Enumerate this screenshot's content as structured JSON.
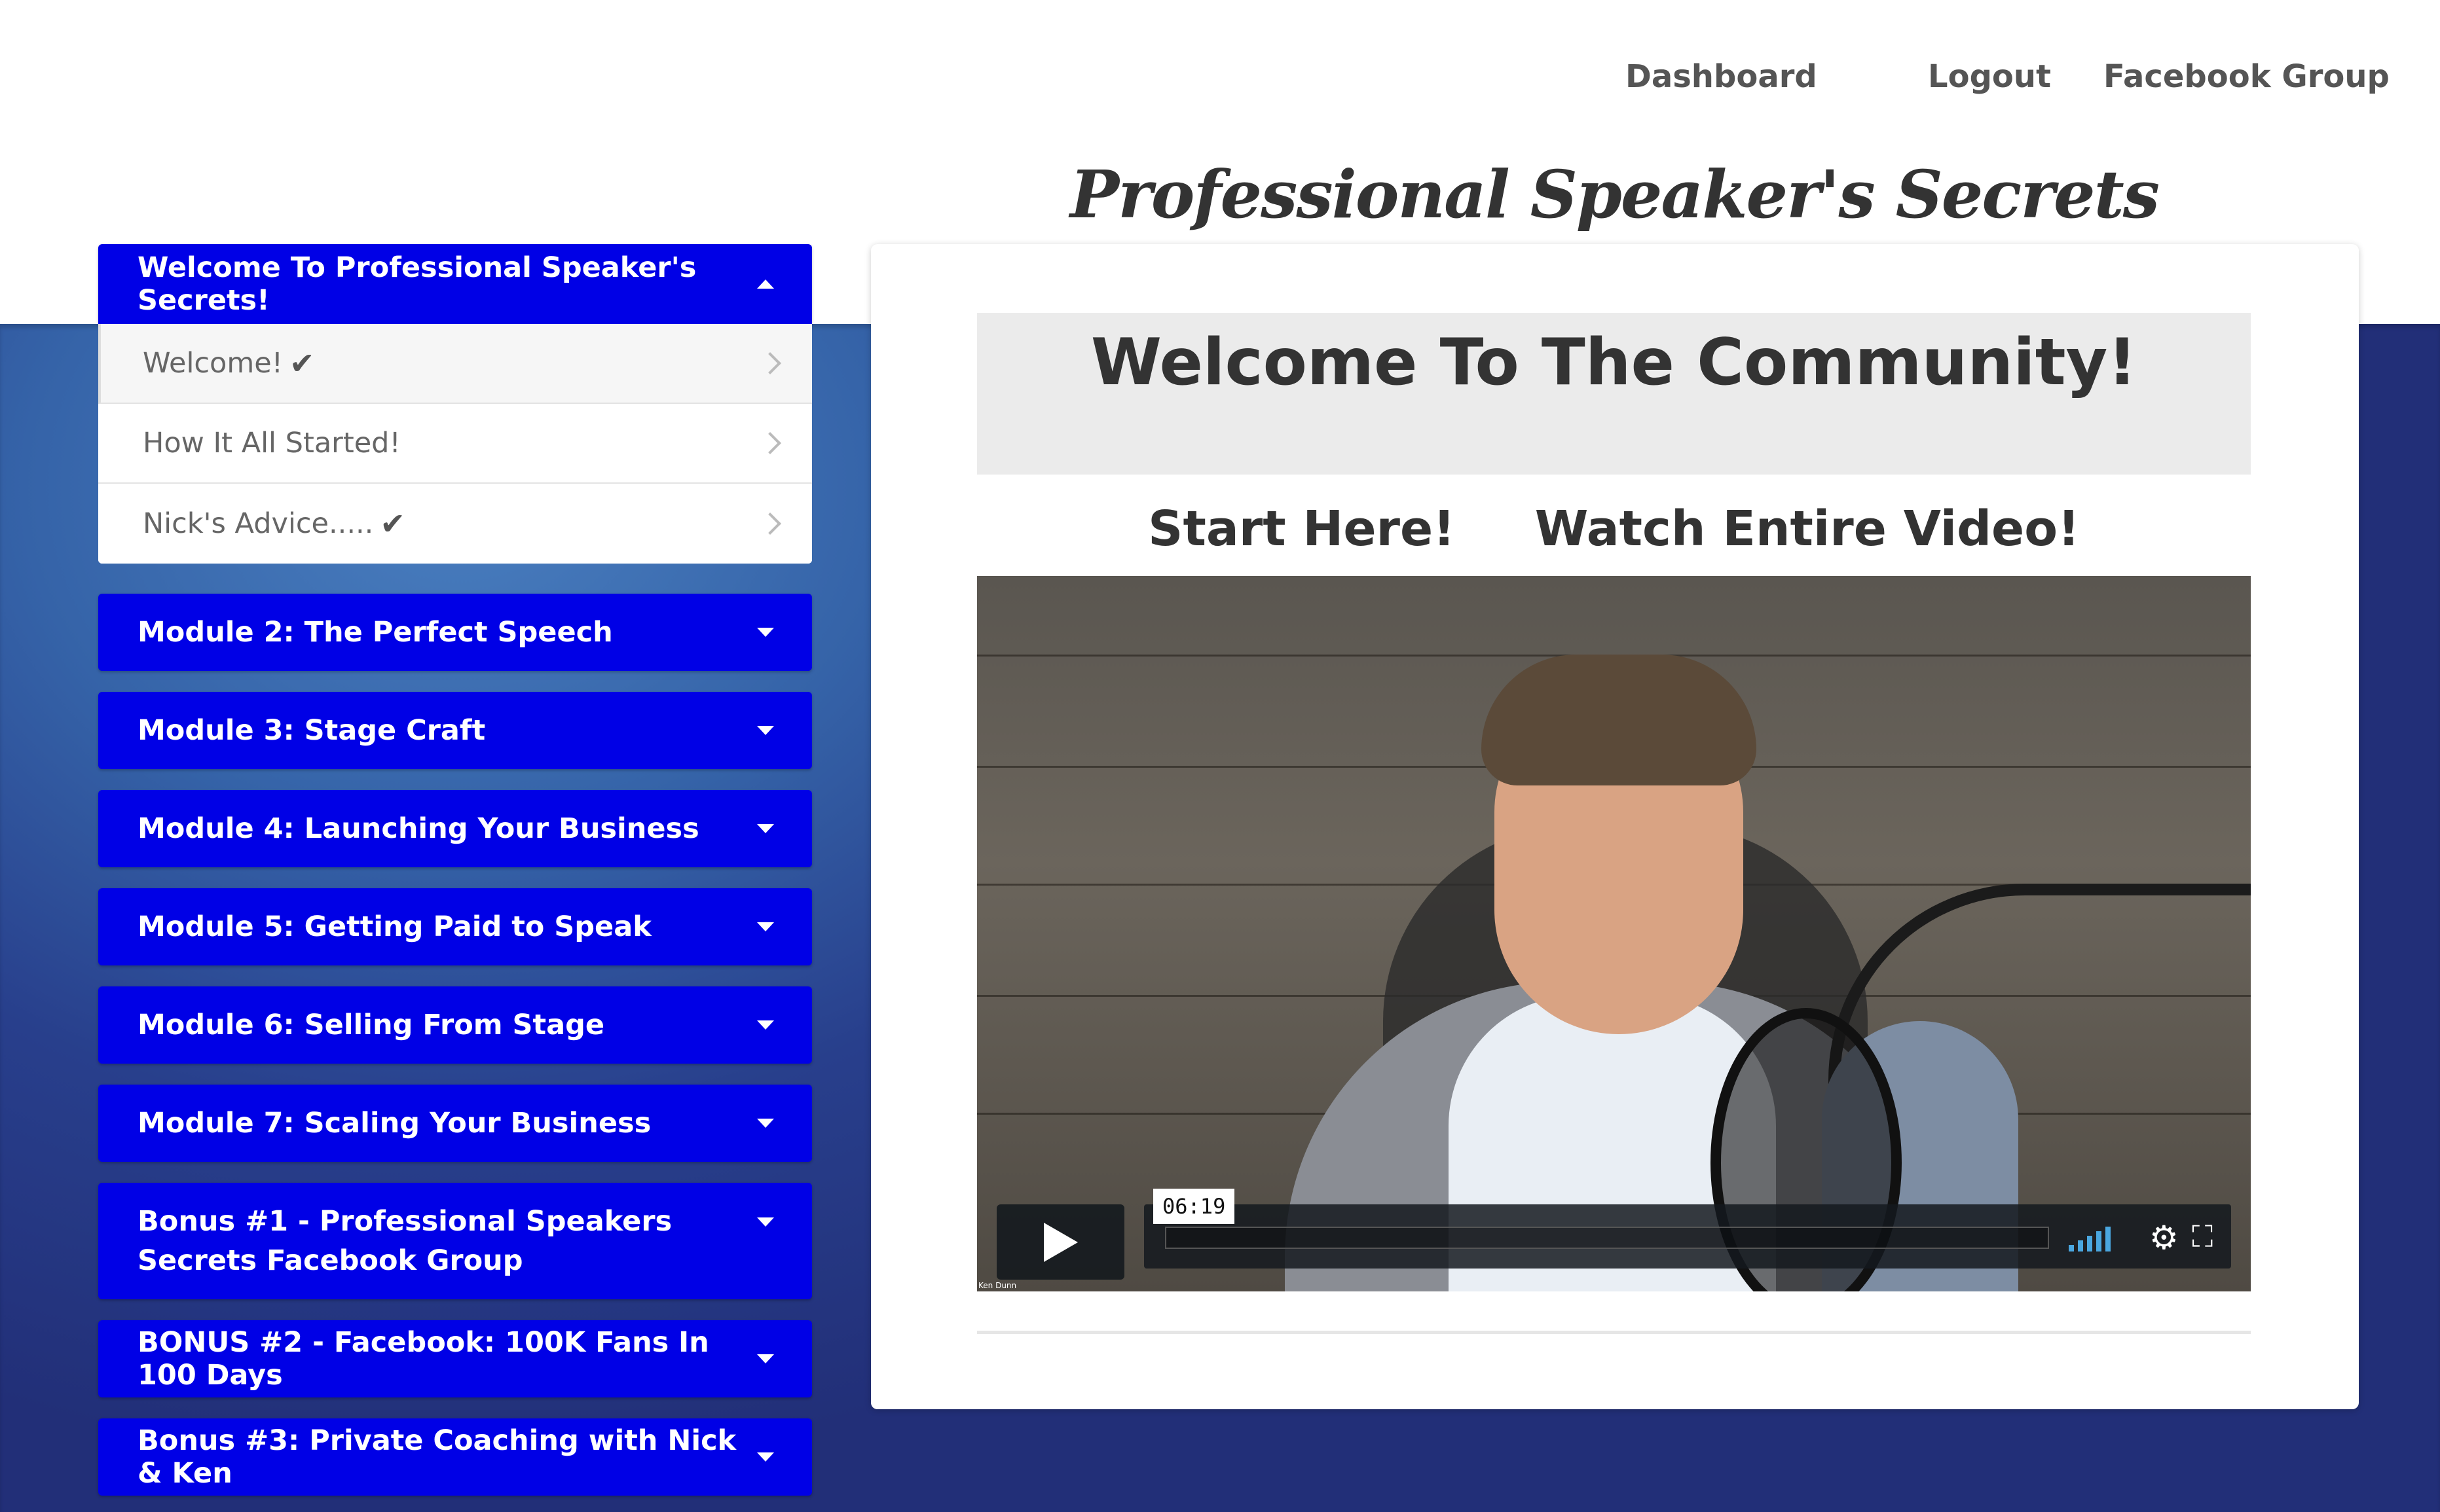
{
  "nav": {
    "dashboard": "Dashboard",
    "logout": "Logout",
    "facebook_group": "Facebook Group"
  },
  "site_title": "Professional Speaker's Secrets",
  "sidebar": {
    "open_section": {
      "title": "Welcome To Professional Speaker's Secrets!",
      "lessons": [
        {
          "label": "Welcome!",
          "completed": true,
          "active": true
        },
        {
          "label": "How It All Started!",
          "completed": false,
          "active": false
        },
        {
          "label": "Nick's Advice.....",
          "completed": true,
          "active": false
        }
      ]
    },
    "sections": [
      "Module 2: The Perfect Speech",
      "Module 3: Stage Craft",
      "Module 4: Launching Your Business",
      "Module 5: Getting Paid to Speak",
      "Module 6: Selling From Stage",
      "Module 7: Scaling Your Business",
      "Bonus #1 - Professional Speakers Secrets Facebook Group",
      "BONUS #2 - Facebook: 100K Fans In 100 Days",
      "Bonus #3: Private Coaching with Nick & Ken"
    ]
  },
  "main": {
    "heading": "Welcome To The Community!",
    "start_here": "Start Here!",
    "watch_video": "Watch Entire Video!",
    "video": {
      "duration_tooltip": "06:19",
      "watermark": "Ken Dunn",
      "progress": 0
    }
  },
  "colors": {
    "accordion_blue": "#0000e6",
    "background_blue": "#2b4a95",
    "volume_blue": "#4aa7e0"
  },
  "icons": {
    "check": "check-icon",
    "chevron": "chevron-right-icon",
    "caret_down": "caret-down-icon",
    "caret_up": "caret-up-icon",
    "play": "play-icon",
    "volume": "volume-icon",
    "settings": "gear-icon",
    "fullscreen": "fullscreen-icon"
  }
}
